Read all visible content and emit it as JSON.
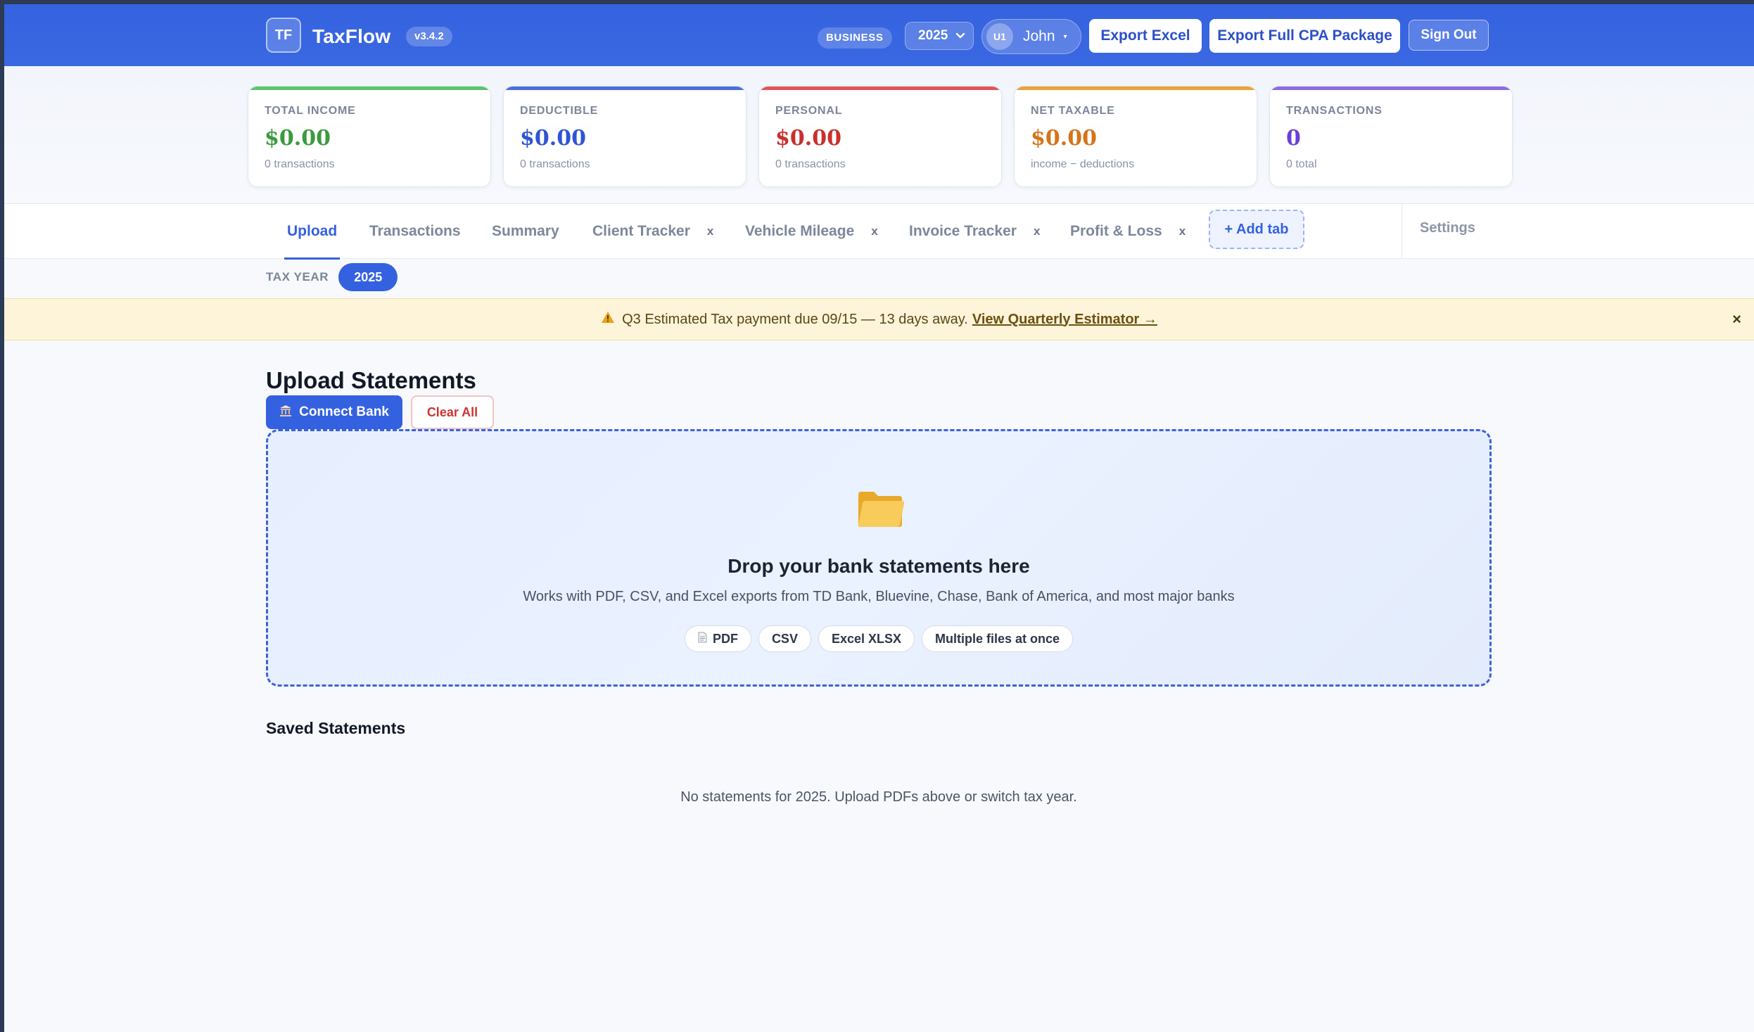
{
  "header": {
    "logo": "TF",
    "app_name": "TaxFlow",
    "version": "v3.4.2",
    "plan": "BUSINESS",
    "year": "2025",
    "user_initials": "U1",
    "user_name": "John",
    "export_excel": "Export Excel",
    "export_cpa": "Export Full CPA Package",
    "sign_out": "Sign Out"
  },
  "stats": [
    {
      "label": "TOTAL INCOME",
      "value": "$0.00",
      "sub": "0 transactions",
      "color": "#3a9a3e",
      "bar": "#5cc46a"
    },
    {
      "label": "DEDUCTIBLE",
      "value": "$0.00",
      "sub": "0 transactions",
      "color": "#2f55d4",
      "bar": "#4a6fe0"
    },
    {
      "label": "PERSONAL",
      "value": "$0.00",
      "sub": "0 transactions",
      "color": "#c9302c",
      "bar": "#e05555"
    },
    {
      "label": "NET TAXABLE",
      "value": "$0.00",
      "sub": "income − deductions",
      "color": "#d4741a",
      "bar": "#e8a23a"
    },
    {
      "label": "TRANSACTIONS",
      "value": "0",
      "sub": "0 total",
      "color": "#6d3fd9",
      "bar": "#8c6be6"
    }
  ],
  "tabs": {
    "upload": "Upload",
    "transactions": "Transactions",
    "summary": "Summary",
    "client_tracker": "Client Tracker",
    "vehicle_mileage": "Vehicle Mileage",
    "invoice_tracker": "Invoice Tracker",
    "profit_loss": "Profit & Loss",
    "close": "x",
    "add_tab": "+ Add tab",
    "settings": "Settings"
  },
  "tax_year": {
    "label": "TAX YEAR",
    "value": "2025"
  },
  "notice": {
    "text": "Q3 Estimated Tax payment due 09/15 — 13 days away.",
    "link": "View Quarterly Estimator →",
    "close": "×"
  },
  "upload": {
    "title": "Upload Statements",
    "connect_bank": "Connect Bank",
    "clear_all": "Clear All",
    "drop_title": "Drop your bank statements here",
    "drop_sub": "Works with PDF, CSV, and Excel exports from TD Bank, Bluevine, Chase, Bank of America, and most major banks",
    "chips": [
      "PDF",
      "CSV",
      "Excel XLSX",
      "Multiple files at once"
    ]
  },
  "saved": {
    "title": "Saved Statements",
    "empty": "No statements for 2025. Upload PDFs above or switch tax year."
  },
  "icons": {
    "warning": "warning-icon",
    "folder": "folder-icon",
    "bank": "bank-icon",
    "document": "document-icon"
  }
}
